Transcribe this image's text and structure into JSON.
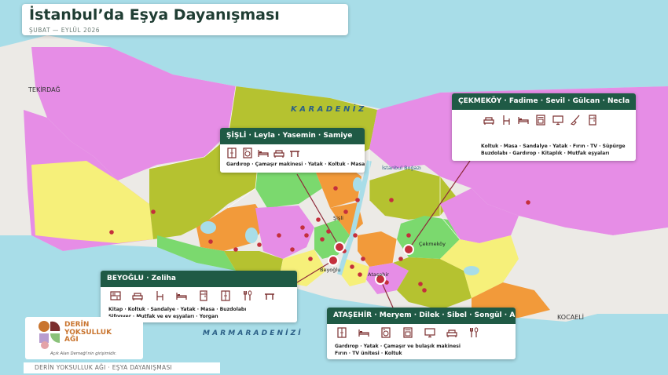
{
  "title": "İstanbul’da Eşya Dayanışması",
  "subtitle": "ŞUBAT — EYLÜL 2026",
  "map_labels": {
    "tekirdag": "TEKİRDAĞ",
    "karadeniz": "K A R A D E N İ Z",
    "marmara": "M A R M A R A   D E N İ Z İ",
    "kocaeli": "KOCAELİ",
    "bogaz": "İstanbul Boğazı",
    "sisli": "Şişli",
    "beyoglu": "Beyoğlu",
    "atasehir": "Ataşehir",
    "cekmekoy": "Çekmeköy"
  },
  "cards": {
    "sisli": {
      "header": "ŞİŞLİ · Leyla · Yasemin · Samiye",
      "icons": [
        "wardrobe-icon",
        "washing-machine-icon",
        "bed-icon",
        "armchair-icon",
        "table-icon"
      ],
      "items": [
        "Gardırop · Çamaşır makinesi · Yatak · Koltuk · Masa"
      ]
    },
    "cekmekoy": {
      "header": "ÇEKMEKÖY · Fadime · Sevil · Gülcan · Necla",
      "icons": [
        "armchair-icon",
        "chair-icon",
        "bed-icon",
        "oven-icon",
        "tv-icon",
        "broom-icon",
        "fridge-icon"
      ],
      "items": [
        "Koltuk · Masa · Sandalye · Yatak · Fırın · TV · Süpürge",
        "Buzdolabı · Gardırop · Kitaplık · Mutfak eşyaları"
      ]
    },
    "beyoglu": {
      "header": "BEYOĞLU · Zeliha",
      "icons": [
        "bookshelf-icon",
        "armchair-icon",
        "chair-icon",
        "bed-icon",
        "fridge-icon",
        "wardrobe-icon",
        "kitchen-utensils-icon",
        "table-icon"
      ],
      "items": [
        "Kitap · Koltuk · Sandalye · Yatak · Masa · Buzdolabı",
        "Şifonyer · Mutfak ve ev eşyaları · Yorgan"
      ]
    },
    "atasehir": {
      "header": "ATAŞEHİR · Meryem · Dilek · Sibel · Songül · Arzu",
      "icons": [
        "wardrobe-icon",
        "bed-icon",
        "washing-machine-icon",
        "oven-icon",
        "tv-icon",
        "armchair-icon",
        "kitchen-utensils-icon"
      ],
      "items": [
        "Gardırop · Yatak · Çamaşır ve bulaşık makinesi",
        "Fırın · TV ünitesi · Koltuk"
      ]
    }
  },
  "logo": {
    "name": "DERİN\nYOKSULLUK\nAĞI",
    "tagline": "Açık Alan Derneği'nin girişimidir."
  },
  "footer": "DERİN YOKSULLUK AĞI · EŞYA DAYANIŞMASI",
  "colors": {
    "header_green": "#1f5a45",
    "marker_red": "#c42f3c",
    "sea": "#a8dde8",
    "leader_line": "#8e2a3a"
  }
}
